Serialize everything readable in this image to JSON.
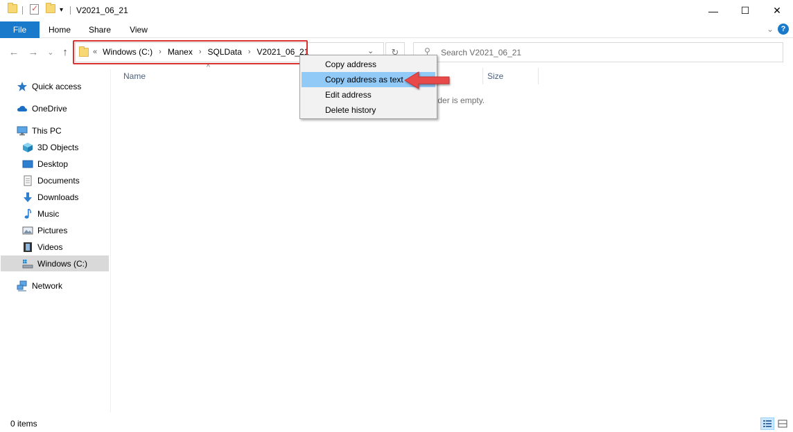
{
  "window": {
    "title": "V2021_06_21",
    "minimize": "—",
    "maximize": "☐",
    "close": "✕"
  },
  "ribbon": {
    "tabs": [
      {
        "label": "File"
      },
      {
        "label": "Home"
      },
      {
        "label": "Share"
      },
      {
        "label": "View"
      }
    ],
    "expand_icon": "chevron-down-icon",
    "help_label": "?"
  },
  "nav": {
    "back": "←",
    "forward": "→",
    "recent": "⌄",
    "up": "↑"
  },
  "address": {
    "lead": "«",
    "crumbs": [
      "Windows (C:)",
      "Manex",
      "SQLData",
      "V2021_06_21"
    ],
    "separator": "›",
    "dropdown": "⌄",
    "refresh": "↻",
    "highlight_color": "#d93030"
  },
  "search": {
    "placeholder": "Search V2021_06_21"
  },
  "sidebar": {
    "items": [
      {
        "label": "Quick access"
      },
      {
        "label": "OneDrive"
      },
      {
        "label": "This PC"
      },
      {
        "label": "3D Objects"
      },
      {
        "label": "Desktop"
      },
      {
        "label": "Documents"
      },
      {
        "label": "Downloads"
      },
      {
        "label": "Music"
      },
      {
        "label": "Pictures"
      },
      {
        "label": "Videos"
      },
      {
        "label": "Windows (C:)"
      },
      {
        "label": "Network"
      }
    ],
    "selected": "Windows (C:)"
  },
  "columns": {
    "name": "Name",
    "size": "Size",
    "sort_indicator": "^"
  },
  "content": {
    "empty_message": "older is empty."
  },
  "context_menu": {
    "items": [
      {
        "label": "Copy address"
      },
      {
        "label": "Copy address as text"
      },
      {
        "label": "Edit address"
      },
      {
        "label": "Delete history"
      }
    ],
    "hovered": "Copy address as text"
  },
  "status": {
    "item_count": "0 items"
  },
  "colors": {
    "accent": "#1979ca",
    "menu_hover": "#91c9f7",
    "annotation": "#e84848"
  }
}
